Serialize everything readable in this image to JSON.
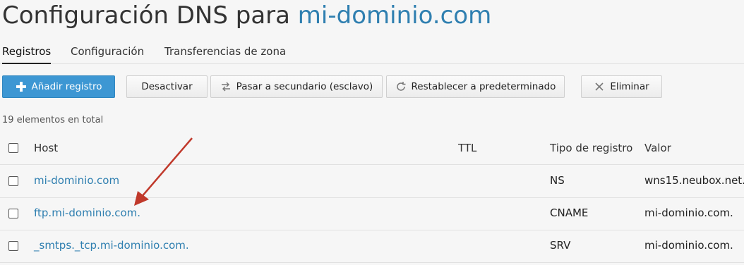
{
  "page": {
    "title_prefix": "Configuración DNS para",
    "title_domain": "mi-dominio.com"
  },
  "tabs": [
    {
      "label": "Registros",
      "active": true
    },
    {
      "label": "Configuración",
      "active": false
    },
    {
      "label": "Transferencias de zona",
      "active": false
    }
  ],
  "toolbar": {
    "add_label": "Añadir registro",
    "deactivate_label": "Desactivar",
    "secondary_label": "Pasar a secundario (esclavo)",
    "reset_label": "Restablecer a predeterminado",
    "delete_label": "Eliminar"
  },
  "list": {
    "count_text": "19 elementos en total",
    "headers": {
      "host": "Host",
      "ttl": "TTL",
      "type": "Tipo de registro",
      "value": "Valor"
    },
    "rows": [
      {
        "host": "mi-dominio.com",
        "ttl": "",
        "type": "NS",
        "value": "wns15.neubox.net."
      },
      {
        "host": "ftp.mi-dominio.com.",
        "ttl": "",
        "type": "CNAME",
        "value": "mi-dominio.com."
      },
      {
        "host": "_smtps._tcp.mi-dominio.com.",
        "ttl": "",
        "type": "SRV",
        "value": "mi-dominio.com."
      }
    ]
  },
  "colors": {
    "accent": "#2f7fb0",
    "primary_button": "#3d97d3",
    "annotation_arrow": "#c0392b"
  },
  "icons": {
    "add": "plus-icon",
    "secondary": "swap-arrows-icon",
    "reset": "reset-icon",
    "delete": "x-icon"
  }
}
